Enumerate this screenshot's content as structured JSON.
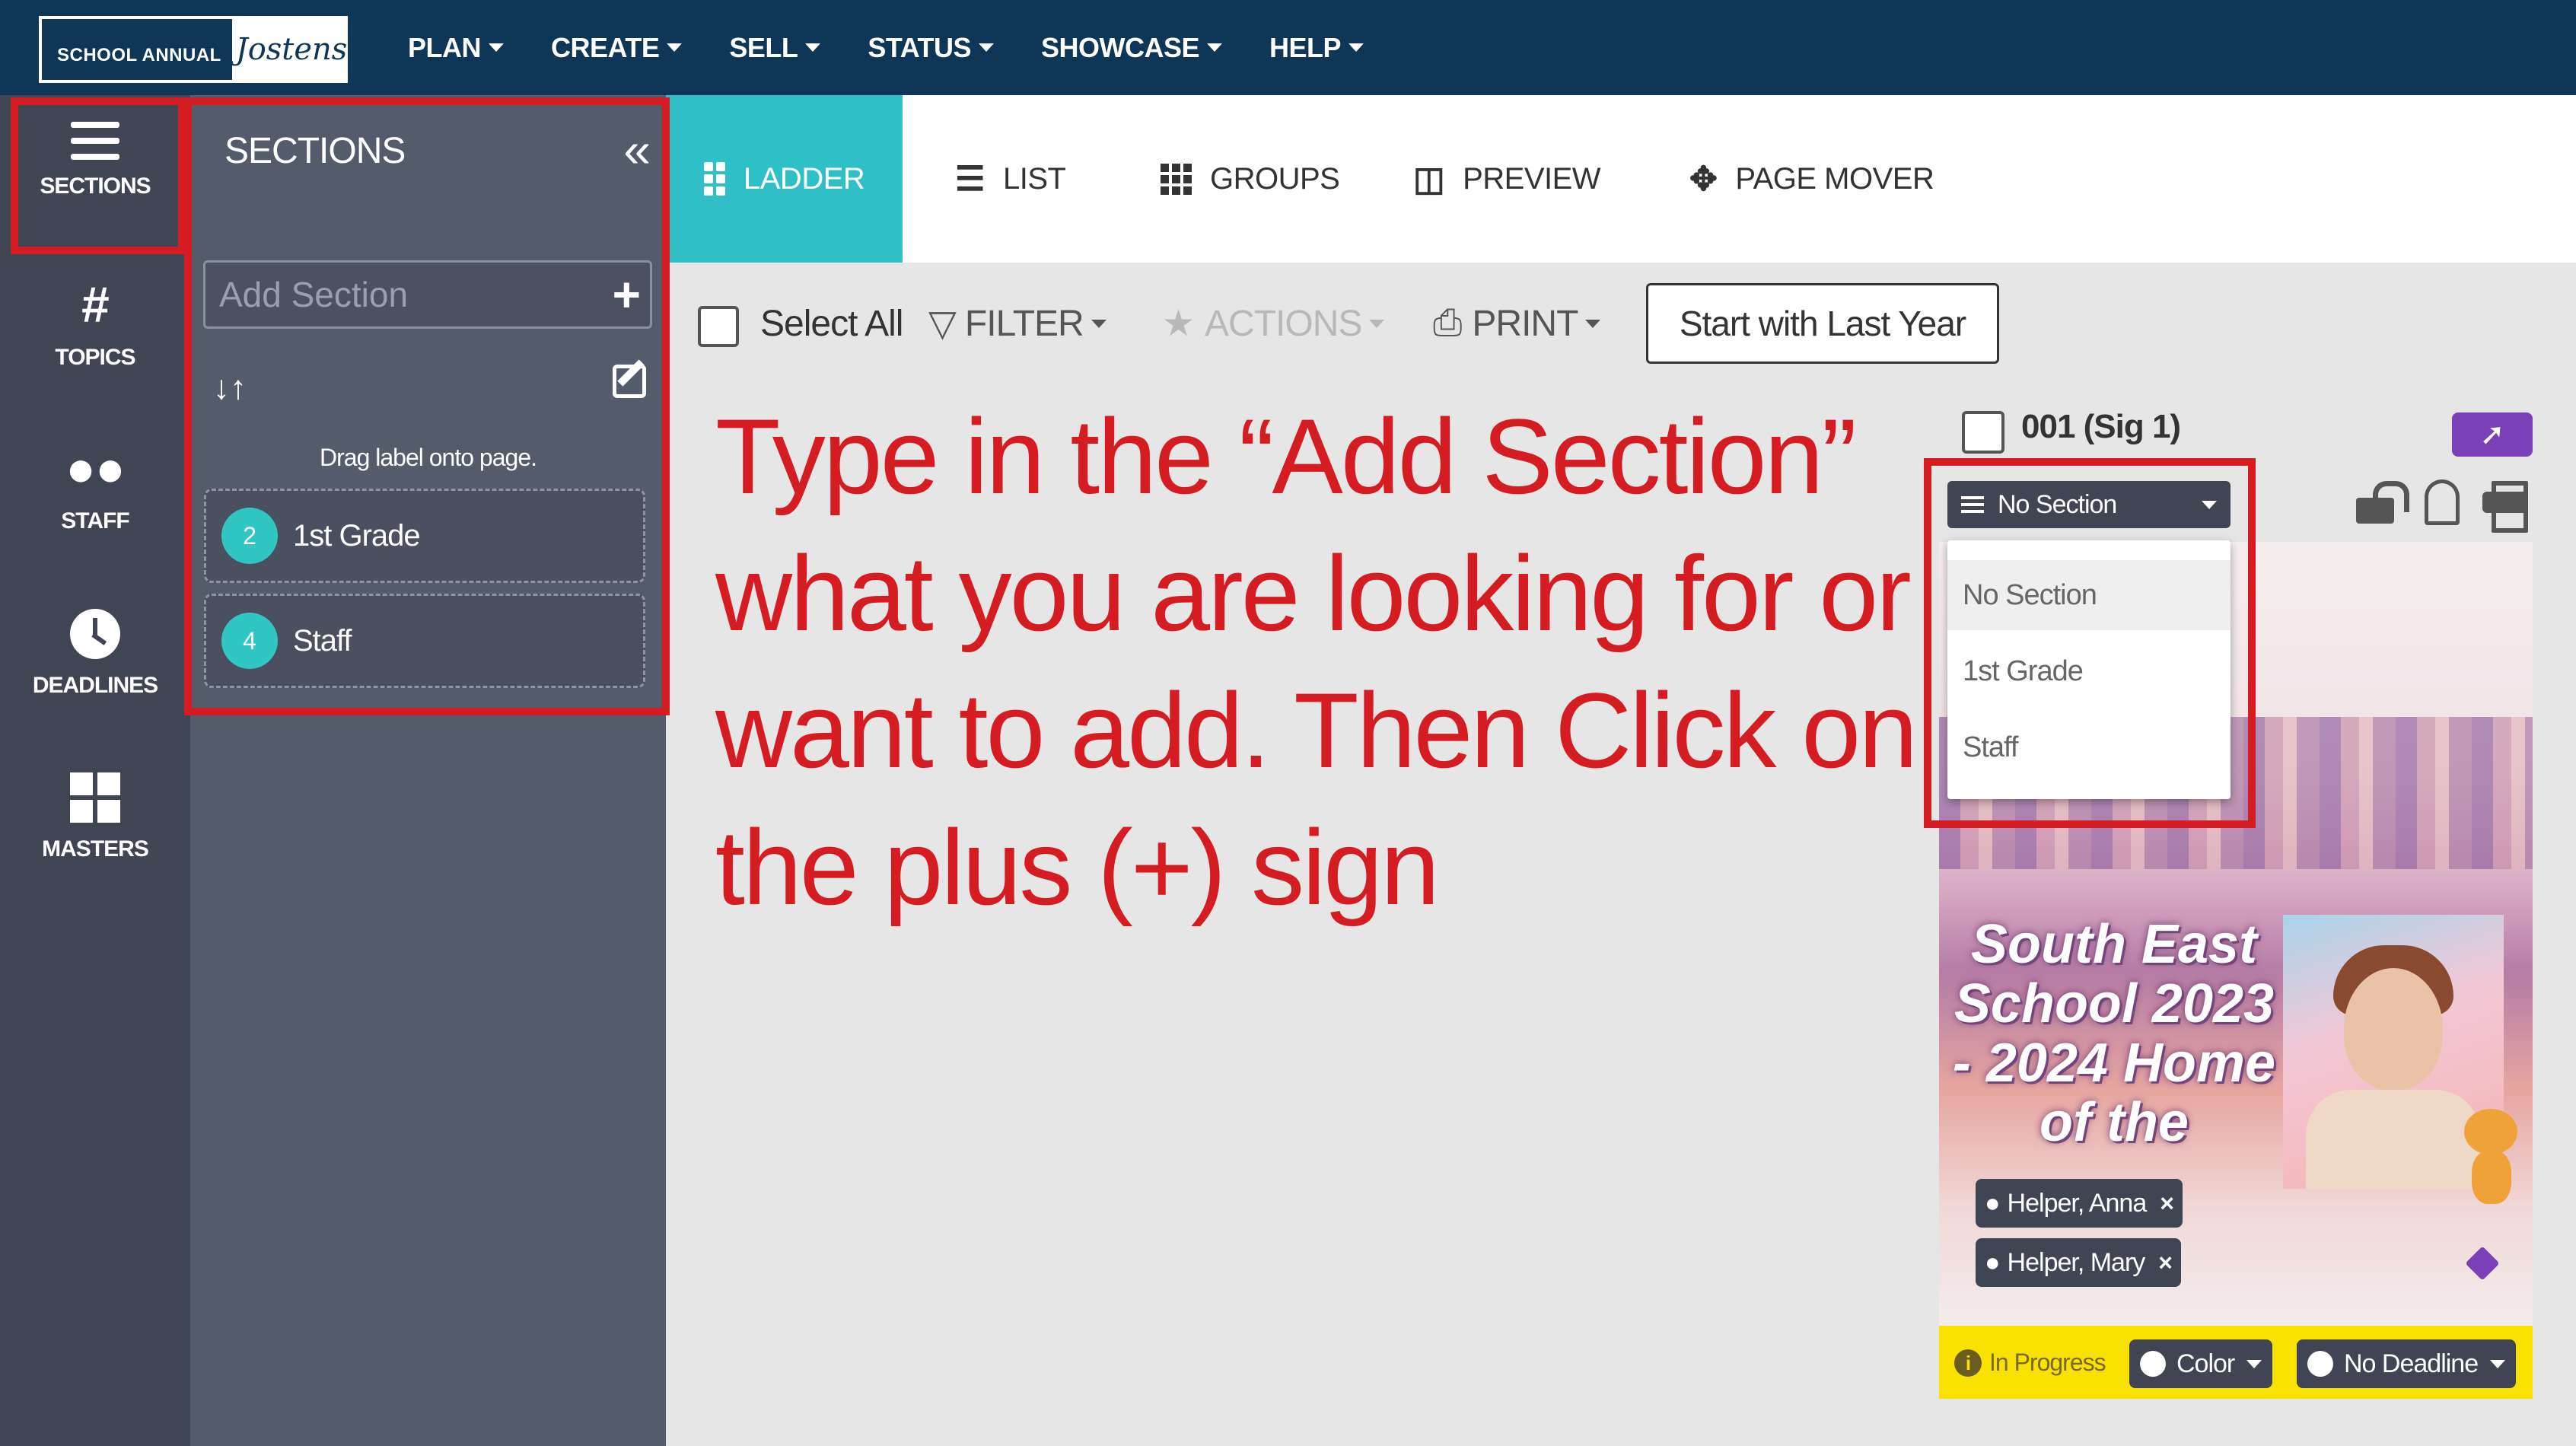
{
  "header": {
    "logo_left": "SCHOOL ANNUAL",
    "logo_right": "Jostens",
    "nav": [
      "PLAN",
      "CREATE",
      "SELL",
      "STATUS",
      "SHOWCASE",
      "HELP"
    ]
  },
  "rail": {
    "items": [
      "SECTIONS",
      "TOPICS",
      "STAFF",
      "DEADLINES",
      "MASTERS"
    ]
  },
  "sections_panel": {
    "title": "SECTIONS",
    "add_placeholder": "Add Section",
    "hint": "Drag label onto page.",
    "items": [
      {
        "count": "2",
        "label": "1st Grade"
      },
      {
        "count": "4",
        "label": "Staff"
      }
    ]
  },
  "tabs": [
    "LADDER",
    "LIST",
    "GROUPS",
    "PREVIEW",
    "PAGE MOVER"
  ],
  "toolbar": {
    "select_all": "Select All",
    "filter": "FILTER",
    "actions": "ACTIONS",
    "print": "PRINT",
    "start_last_year": "Start with Last Year"
  },
  "instruction": "Type in the “Add Section” what you are looking for or want to add.  Then Click on the plus (+) sign",
  "page_card": {
    "title": "001 (Sig 1)",
    "section_select": "No Section",
    "section_options": [
      "No Section",
      "1st Grade",
      "Staff"
    ],
    "preview_title": "South East School 2023 - 2024 Home of the",
    "helpers": [
      "Helper, Anna",
      "Helper, Mary"
    ],
    "status": "In Progress",
    "color_label": "Color",
    "deadline_label": "No Deadline"
  },
  "colors": {
    "topbar": "#0f3557",
    "rail": "#3f4552",
    "panel": "#545b6b",
    "accent": "#2fbfc7",
    "highlight": "#d41c22",
    "status_bar": "#fae200",
    "share": "#7b3fb7"
  },
  "icons": [
    "hamburger-icon",
    "hash-icon",
    "users-icon",
    "clock-icon",
    "grid-icon",
    "double-chevron-left-icon",
    "plus-icon",
    "sort-icon",
    "edit-icon",
    "filter-icon",
    "star-icon",
    "print-icon",
    "share-icon",
    "lock-icon",
    "ghost-icon"
  ]
}
